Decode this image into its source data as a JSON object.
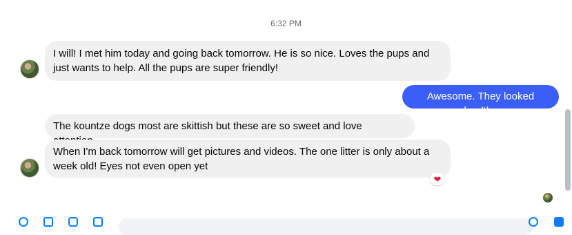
{
  "chat": {
    "timestamp": "6:32 PM",
    "messages": [
      {
        "from": "them",
        "text": "I will! I met him today and going back tomorrow. He is so nice. Loves the pups and just wants to help. All the pups are super friendly!"
      },
      {
        "from": "me",
        "text": "Awesome. They looked healthy"
      },
      {
        "from": "them",
        "text": "The kountze dogs most are skittish but these are so sweet and love attention."
      },
      {
        "from": "them",
        "text": "When I'm back tomorrow will get pictures and videos. The one litter is only about a week old! Eyes not even open yet",
        "reaction": "❤"
      }
    ]
  },
  "colors": {
    "outgoing_bubble": "#3a5ef7",
    "incoming_bubble": "#f0f0f0",
    "accent": "#0a7cff",
    "reaction": "#e41e3f"
  },
  "icons": {
    "avatar": "contact-avatar",
    "reaction": "heart-icon",
    "read_receipt": "seen-avatar"
  }
}
